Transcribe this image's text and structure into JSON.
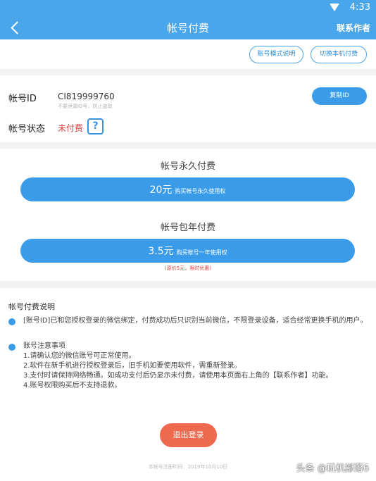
{
  "status_bar": {
    "time": "4:33"
  },
  "header": {
    "title": "帐号付费",
    "contact_author": "联系作者"
  },
  "top_buttons": {
    "account_mode_info": "账号模式说明",
    "switch_local_pay": "切换本机付费"
  },
  "account": {
    "id_label": "帐号ID",
    "id_value": "CI819999760",
    "id_hint": "不要泄漏ID号，防止盗取",
    "copy_button": "复制ID",
    "status_label": "帐号状态",
    "status_value": "未付费",
    "help_icon": "?"
  },
  "payment": {
    "permanent_title": "帐号永久付费",
    "permanent_price": "20元",
    "permanent_desc": "购买帐号永久使用权",
    "yearly_title": "帐号包年付费",
    "yearly_price": "3.5元",
    "yearly_desc": "购买帐号一年使用权",
    "original_price_note": "(原价5元，限时优惠)"
  },
  "info": {
    "heading": "帐号付费说明",
    "bullet1": "[账号ID]已和您授权登录的微信绑定，付费成功后只识别当前微信，不限登录设备，适合经常更换手机的用户。",
    "bullet2_title": "账号注意事项",
    "bullet2_lines": [
      "1.请确认您的微信账号可正常使用。",
      "2.软件在新手机进行授权登录后，旧手机如要使用软件，需重新登录。",
      "3.支付时请保持网络畅通。如成功支付后仍显示未付费，请使用本页面右上角的【联系作者】功能。",
      "4.账号权限购买后不支持退款。"
    ]
  },
  "footer": {
    "logout_button": "退出登录",
    "register_time": "本帐号注册时间：2019年10月10日",
    "watermark": "头条 @玩机部落6"
  },
  "colors": {
    "primary_blue": "#4aa6ea",
    "button_blue": "#3a9be8",
    "logout_red": "#ee6a4e",
    "unpaid_red": "#e04040"
  }
}
